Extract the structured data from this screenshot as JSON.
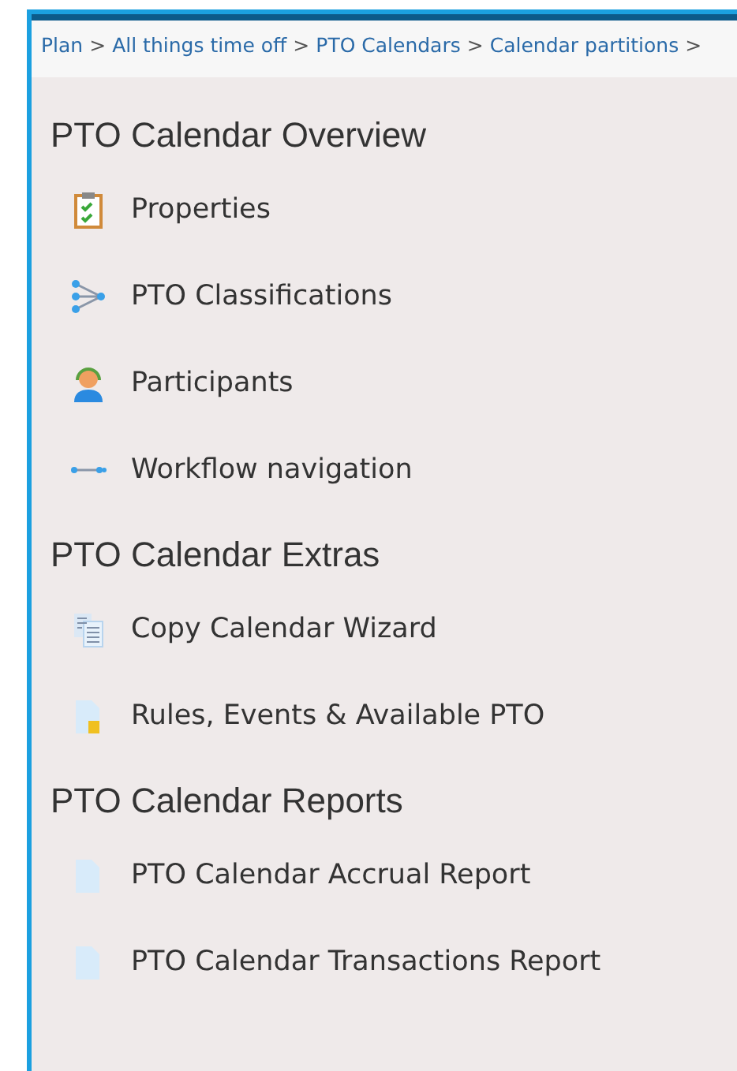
{
  "breadcrumb": [
    {
      "kind": "link",
      "text": "Plan"
    },
    {
      "kind": "separator",
      "text": ">"
    },
    {
      "kind": "link",
      "text": "All things time off"
    },
    {
      "kind": "separator",
      "text": ">"
    },
    {
      "kind": "link",
      "text": "PTO Calendars"
    },
    {
      "kind": "separator",
      "text": ">"
    },
    {
      "kind": "link",
      "text": "Calendar partitions"
    },
    {
      "kind": "separator",
      "text": ">"
    }
  ],
  "sections": [
    {
      "title": "PTO Calendar Overview",
      "items": [
        {
          "label": "Properties",
          "kind": "clipboard"
        },
        {
          "label": "PTO Classifications",
          "kind": "branch"
        },
        {
          "label": "Participants",
          "kind": "person"
        },
        {
          "label": "Workflow navigation",
          "kind": "workflow"
        }
      ]
    },
    {
      "title": "PTO Calendar Extras",
      "items": [
        {
          "label": "Copy Calendar Wizard",
          "kind": "copy"
        },
        {
          "label": "Rules, Events & Available PTO",
          "kind": "scroll"
        }
      ]
    },
    {
      "title": "PTO Calendar Reports",
      "items": [
        {
          "label": "PTO Calendar Accrual Report",
          "kind": "document"
        },
        {
          "label": "PTO Calendar Transactions Report",
          "kind": "document"
        }
      ]
    }
  ]
}
